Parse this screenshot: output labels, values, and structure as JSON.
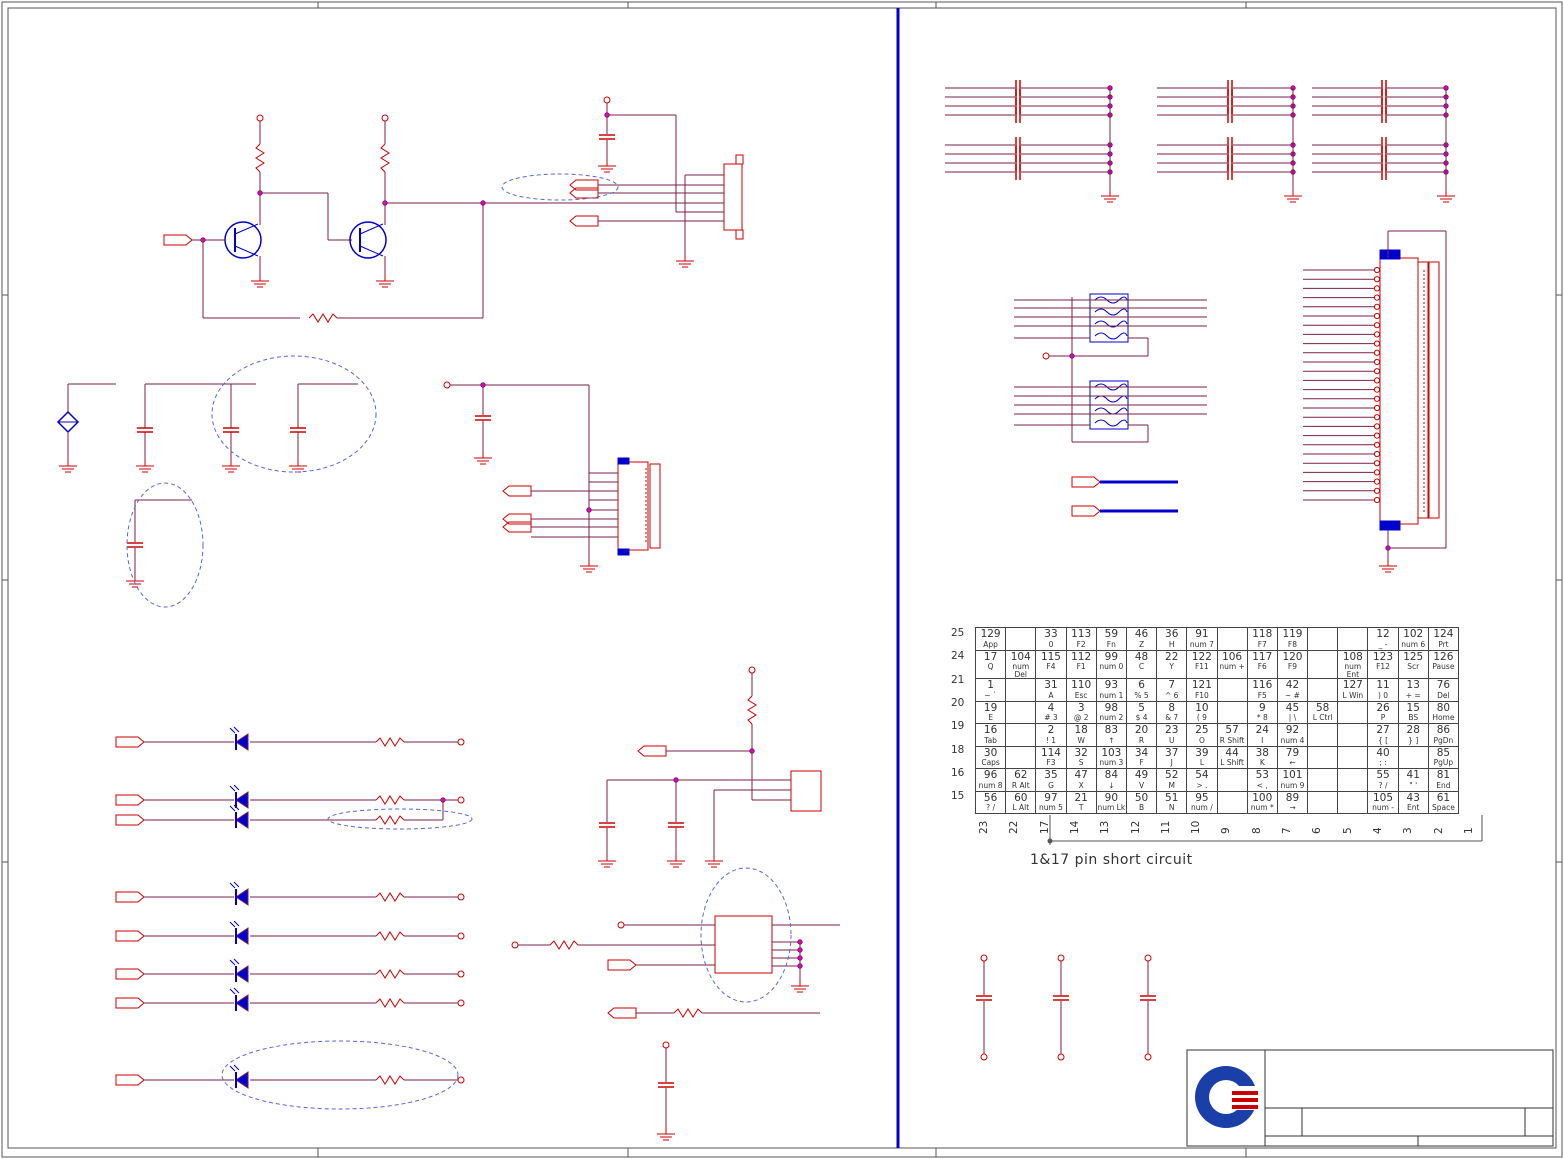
{
  "diagram": {
    "colors": {
      "wire": "#7a1f4a",
      "component": "#cc0000",
      "accent": "#0000cc",
      "junction": "#e000e0"
    }
  },
  "keyboard_matrix": {
    "row_labels": [
      "25",
      "24",
      "21",
      "20",
      "19",
      "18",
      "16",
      "15"
    ],
    "column_labels": [
      "23",
      "22",
      "17",
      "14",
      "13",
      "12",
      "11",
      "10",
      "9",
      "8",
      "7",
      "6",
      "5",
      "4",
      "3",
      "2",
      "1"
    ],
    "rows": [
      [
        [
          "129",
          "App"
        ],
        [
          "",
          ""
        ],
        [
          "33",
          "0"
        ],
        [
          "113",
          "F2"
        ],
        [
          "59",
          "Fn"
        ],
        [
          "46",
          "Z"
        ],
        [
          "36",
          "H"
        ],
        [
          "91",
          "num 7"
        ],
        [
          "",
          ""
        ],
        [
          "118",
          "F7"
        ],
        [
          "119",
          "F8"
        ],
        [
          "",
          ""
        ],
        [
          "",
          ""
        ],
        [
          "12",
          "_ -"
        ],
        [
          "102",
          "num 6"
        ],
        [
          "124",
          "Prt"
        ]
      ],
      [
        [
          "17",
          "Q"
        ],
        [
          "104",
          "num Del"
        ],
        [
          "115",
          "F4"
        ],
        [
          "112",
          "F1"
        ],
        [
          "99",
          "num 0"
        ],
        [
          "48",
          "C"
        ],
        [
          "22",
          "Y"
        ],
        [
          "122",
          "F11"
        ],
        [
          "106",
          "num +"
        ],
        [
          "117",
          "F6"
        ],
        [
          "120",
          "F9"
        ],
        [
          "",
          ""
        ],
        [
          "108",
          "num Ent"
        ],
        [
          "123",
          "F12"
        ],
        [
          "125",
          "Scr"
        ],
        [
          "126",
          "Pause"
        ]
      ],
      [
        [
          "1",
          "~ `"
        ],
        [
          "",
          ""
        ],
        [
          "31",
          "A"
        ],
        [
          "110",
          "Esc"
        ],
        [
          "93",
          "num 1"
        ],
        [
          "6",
          "% 5"
        ],
        [
          "7",
          "^ 6"
        ],
        [
          "121",
          "F10"
        ],
        [
          "",
          ""
        ],
        [
          "116",
          "F5"
        ],
        [
          "42",
          "~ #"
        ],
        [
          "",
          ""
        ],
        [
          "127",
          "L Win"
        ],
        [
          "11",
          ") 0"
        ],
        [
          "13",
          "+ ="
        ],
        [
          "76",
          "Del"
        ]
      ],
      [
        [
          "19",
          "E"
        ],
        [
          "",
          ""
        ],
        [
          "4",
          "# 3"
        ],
        [
          "3",
          "@ 2"
        ],
        [
          "98",
          "num 2"
        ],
        [
          "5",
          "$ 4"
        ],
        [
          "8",
          "& 7"
        ],
        [
          "10",
          "( 9"
        ],
        [
          "",
          ""
        ],
        [
          "9",
          "* 8"
        ],
        [
          "45",
          "| \\"
        ],
        [
          "58",
          "L Ctrl"
        ],
        [
          "",
          ""
        ],
        [
          "26",
          "P"
        ],
        [
          "15",
          "BS"
        ],
        [
          "80",
          "Home"
        ]
      ],
      [
        [
          "16",
          "Tab"
        ],
        [
          "",
          ""
        ],
        [
          "2",
          "! 1"
        ],
        [
          "18",
          "W"
        ],
        [
          "83",
          "↑"
        ],
        [
          "20",
          "R"
        ],
        [
          "23",
          "U"
        ],
        [
          "25",
          "O"
        ],
        [
          "57",
          "R Shift"
        ],
        [
          "24",
          "I"
        ],
        [
          "92",
          "num 4"
        ],
        [
          "",
          ""
        ],
        [
          "",
          ""
        ],
        [
          "27",
          "{ ["
        ],
        [
          "28",
          "} ]"
        ],
        [
          "86",
          "PgDn"
        ]
      ],
      [
        [
          "30",
          "Caps"
        ],
        [
          "",
          ""
        ],
        [
          "114",
          "F3"
        ],
        [
          "32",
          "S"
        ],
        [
          "103",
          "num 3"
        ],
        [
          "34",
          "F"
        ],
        [
          "37",
          "J"
        ],
        [
          "39",
          "L"
        ],
        [
          "44",
          "L Shift"
        ],
        [
          "38",
          "K"
        ],
        [
          "79",
          "←"
        ],
        [
          "",
          ""
        ],
        [
          "",
          ""
        ],
        [
          "40",
          "; :"
        ],
        [
          "",
          ""
        ],
        [
          "85",
          "PgUp"
        ]
      ],
      [
        [
          "96",
          "num 8"
        ],
        [
          "62",
          "R Alt"
        ],
        [
          "35",
          "G"
        ],
        [
          "47",
          "X"
        ],
        [
          "84",
          "↓"
        ],
        [
          "49",
          "V"
        ],
        [
          "52",
          "M"
        ],
        [
          "54",
          "> ."
        ],
        [
          "",
          ""
        ],
        [
          "53",
          "< ,"
        ],
        [
          "101",
          "num 9"
        ],
        [
          "",
          ""
        ],
        [
          "",
          ""
        ],
        [
          "55",
          "? /"
        ],
        [
          "41",
          "\" '"
        ],
        [
          "81",
          "End"
        ]
      ],
      [
        [
          "56",
          "? /"
        ],
        [
          "60",
          "L Alt"
        ],
        [
          "97",
          "num 5"
        ],
        [
          "21",
          "T"
        ],
        [
          "90",
          "num Lk"
        ],
        [
          "50",
          "B"
        ],
        [
          "51",
          "N"
        ],
        [
          "95",
          "num /"
        ],
        [
          "",
          ""
        ],
        [
          "100",
          "num *"
        ],
        [
          "89",
          "→"
        ],
        [
          "",
          ""
        ],
        [
          "",
          ""
        ],
        [
          "105",
          "num -"
        ],
        [
          "43",
          "Ent"
        ],
        [
          "61",
          "Space"
        ]
      ]
    ],
    "note": "1&17 pin short circuit"
  }
}
